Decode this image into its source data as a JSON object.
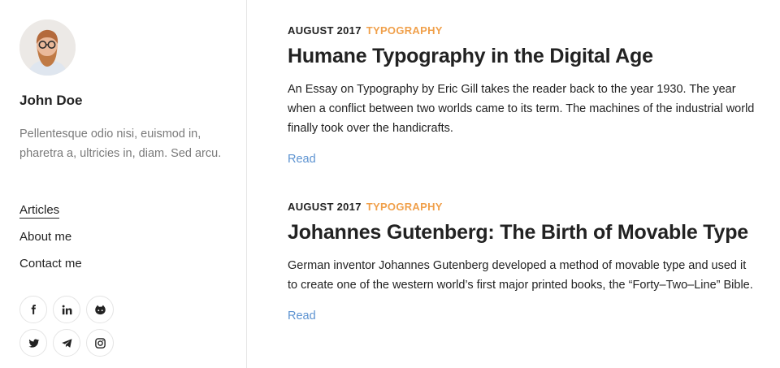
{
  "sidebar": {
    "author_name": "John Doe",
    "bio": "Pellentesque odio nisi, euismod in, pharetra a, ultricies in, diam. Sed arcu.",
    "menu": [
      {
        "label": "Articles",
        "active": true
      },
      {
        "label": "About me",
        "active": false
      },
      {
        "label": "Contact me",
        "active": false
      }
    ],
    "social_icons": [
      "facebook-icon",
      "linkedin-icon",
      "github-icon",
      "twitter-icon",
      "telegram-icon",
      "instagram-icon"
    ]
  },
  "posts": [
    {
      "date": "AUGUST 2017",
      "category": "TYPOGRAPHY",
      "title": "Humane Typography in the Digital Age",
      "excerpt": "An Essay on Typography by Eric Gill takes the reader back to the year 1930. The year when a conflict between two worlds came to its term. The machines of the industrial world finally took over the handicrafts.",
      "read_label": "Read"
    },
    {
      "date": "AUGUST 2017",
      "category": "TYPOGRAPHY",
      "title": "Johannes Gutenberg: The Birth of Movable Type",
      "excerpt": "German inventor Johannes Gutenberg developed a method of movable type and used it to create one of the western world’s first major printed books, the “Forty–Two–Line” Bible.",
      "read_label": "Read"
    }
  ],
  "colors": {
    "category": "#f0a04b",
    "link": "#5d93d1",
    "muted_text": "#7a7a7a",
    "divider": "#e6e6e6"
  }
}
